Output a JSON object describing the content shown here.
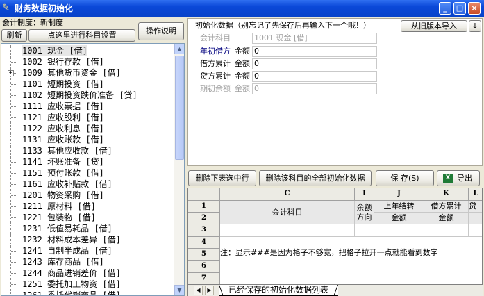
{
  "window": {
    "title": "财务数据初始化",
    "minimize": "_",
    "maximize": "□",
    "close": "×"
  },
  "left": {
    "system_label": "会计制度：新制度",
    "refresh_button": "刷新",
    "subject_setting_button": "点这里进行科目设置",
    "help_button": "操作说明",
    "tree": [
      {
        "code": "1001",
        "name": "现金 [借]",
        "selected": true,
        "expandable": false
      },
      {
        "code": "1002",
        "name": "银行存款 [借]",
        "selected": false,
        "expandable": false
      },
      {
        "code": "1009",
        "name": "其他货币资金 [借]",
        "selected": false,
        "expandable": true
      },
      {
        "code": "1101",
        "name": "短期投资 [借]",
        "selected": false,
        "expandable": false
      },
      {
        "code": "1102",
        "name": "短期投资跌价准备 [贷]",
        "selected": false,
        "expandable": false
      },
      {
        "code": "1111",
        "name": "应收票据 [借]",
        "selected": false,
        "expandable": false
      },
      {
        "code": "1121",
        "name": "应收股利 [借]",
        "selected": false,
        "expandable": false
      },
      {
        "code": "1122",
        "name": "应收利息 [借]",
        "selected": false,
        "expandable": false
      },
      {
        "code": "1131",
        "name": "应收账款 [借]",
        "selected": false,
        "expandable": false
      },
      {
        "code": "1133",
        "name": "其他应收款 [借]",
        "selected": false,
        "expandable": false
      },
      {
        "code": "1141",
        "name": "坏账准备 [贷]",
        "selected": false,
        "expandable": false
      },
      {
        "code": "1151",
        "name": "预付账款 [借]",
        "selected": false,
        "expandable": false
      },
      {
        "code": "1161",
        "name": "应收补贴款 [借]",
        "selected": false,
        "expandable": false
      },
      {
        "code": "1201",
        "name": "物资采购 [借]",
        "selected": false,
        "expandable": false
      },
      {
        "code": "1211",
        "name": "原材料 [借]",
        "selected": false,
        "expandable": false
      },
      {
        "code": "1221",
        "name": "包装物 [借]",
        "selected": false,
        "expandable": false
      },
      {
        "code": "1231",
        "name": "低值易耗品 [借]",
        "selected": false,
        "expandable": false
      },
      {
        "code": "1232",
        "name": "材料成本差异 [借]",
        "selected": false,
        "expandable": false
      },
      {
        "code": "1241",
        "name": "自制半成品 [借]",
        "selected": false,
        "expandable": false
      },
      {
        "code": "1243",
        "name": "库存商品 [借]",
        "selected": false,
        "expandable": false
      },
      {
        "code": "1244",
        "name": "商品进销差价 [借]",
        "selected": false,
        "expandable": false
      },
      {
        "code": "1251",
        "name": "委托加工物资 [借]",
        "selected": false,
        "expandable": false
      },
      {
        "code": "1261",
        "name": "委托代销商品 [借]",
        "selected": false,
        "expandable": false
      }
    ],
    "scroll": {
      "up": "▲",
      "down": "▼"
    }
  },
  "right": {
    "header": "初始化数据（别忘记了先保存后再输入下一个哦！）",
    "import_button": "从旧版本导入",
    "import_arrow": "↓",
    "form": {
      "subject_label": "会计科目",
      "subject_value": "1001 现金 [借]",
      "opening_debit_label": "年初借方",
      "opening_debit_amount_label": "金额",
      "opening_debit_value": "0",
      "debit_total_label": "借方累计",
      "debit_total_amount_label": "金额",
      "debit_total_value": "0",
      "credit_total_label": "贷方累计",
      "credit_total_amount_label": "金额",
      "credit_total_value": "0",
      "period_balance_label": "期初余额",
      "period_balance_amount_label": "金额",
      "period_balance_value": "0"
    },
    "actions": {
      "delete_selected_row": "删除下表选中行",
      "delete_all_init": "删除该科目的全部初始化数据",
      "save": "保 存(S)",
      "export": "导出"
    }
  },
  "sheet": {
    "corner": "",
    "columns": [
      "C",
      "I",
      "J",
      "K",
      "L"
    ],
    "rows": [
      "1",
      "2",
      "3",
      "4",
      "5",
      "6",
      "7"
    ],
    "header_subject": "会计科目",
    "header_balance_dir": "余额方向",
    "header_prev_carry": "上年结转",
    "header_debit_total": "借方累计",
    "header_extra": "贷",
    "header_amount_1": "金额",
    "header_amount_2": "金额",
    "note": "注：显示###是因为格子不够宽，把格子拉开一点就能看到数字",
    "tab_label": "已经保存的初始化数据列表",
    "nav": {
      "prev": "◀",
      "next": "▶"
    }
  }
}
